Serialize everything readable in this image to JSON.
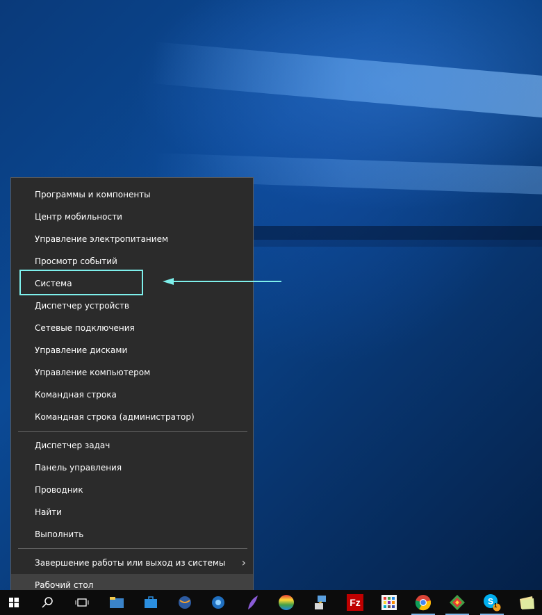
{
  "menu": {
    "section1": [
      "Программы и компоненты",
      "Центр мобильности",
      "Управление электропитанием",
      "Просмотр событий",
      "Система",
      "Диспетчер устройств",
      "Сетевые подключения",
      "Управление дисками",
      "Управление компьютером",
      "Командная строка",
      "Командная строка (администратор)"
    ],
    "section2": [
      "Диспетчер задач",
      "Панель управления",
      "Проводник",
      "Найти",
      "Выполнить"
    ],
    "shutdown": "Завершение работы или выход из системы",
    "desktop": "Рабочий стол"
  },
  "taskbar": {
    "skype_badge": "1"
  },
  "colors": {
    "highlight": "#7ef0ec",
    "menu_bg": "#2b2b2b"
  }
}
